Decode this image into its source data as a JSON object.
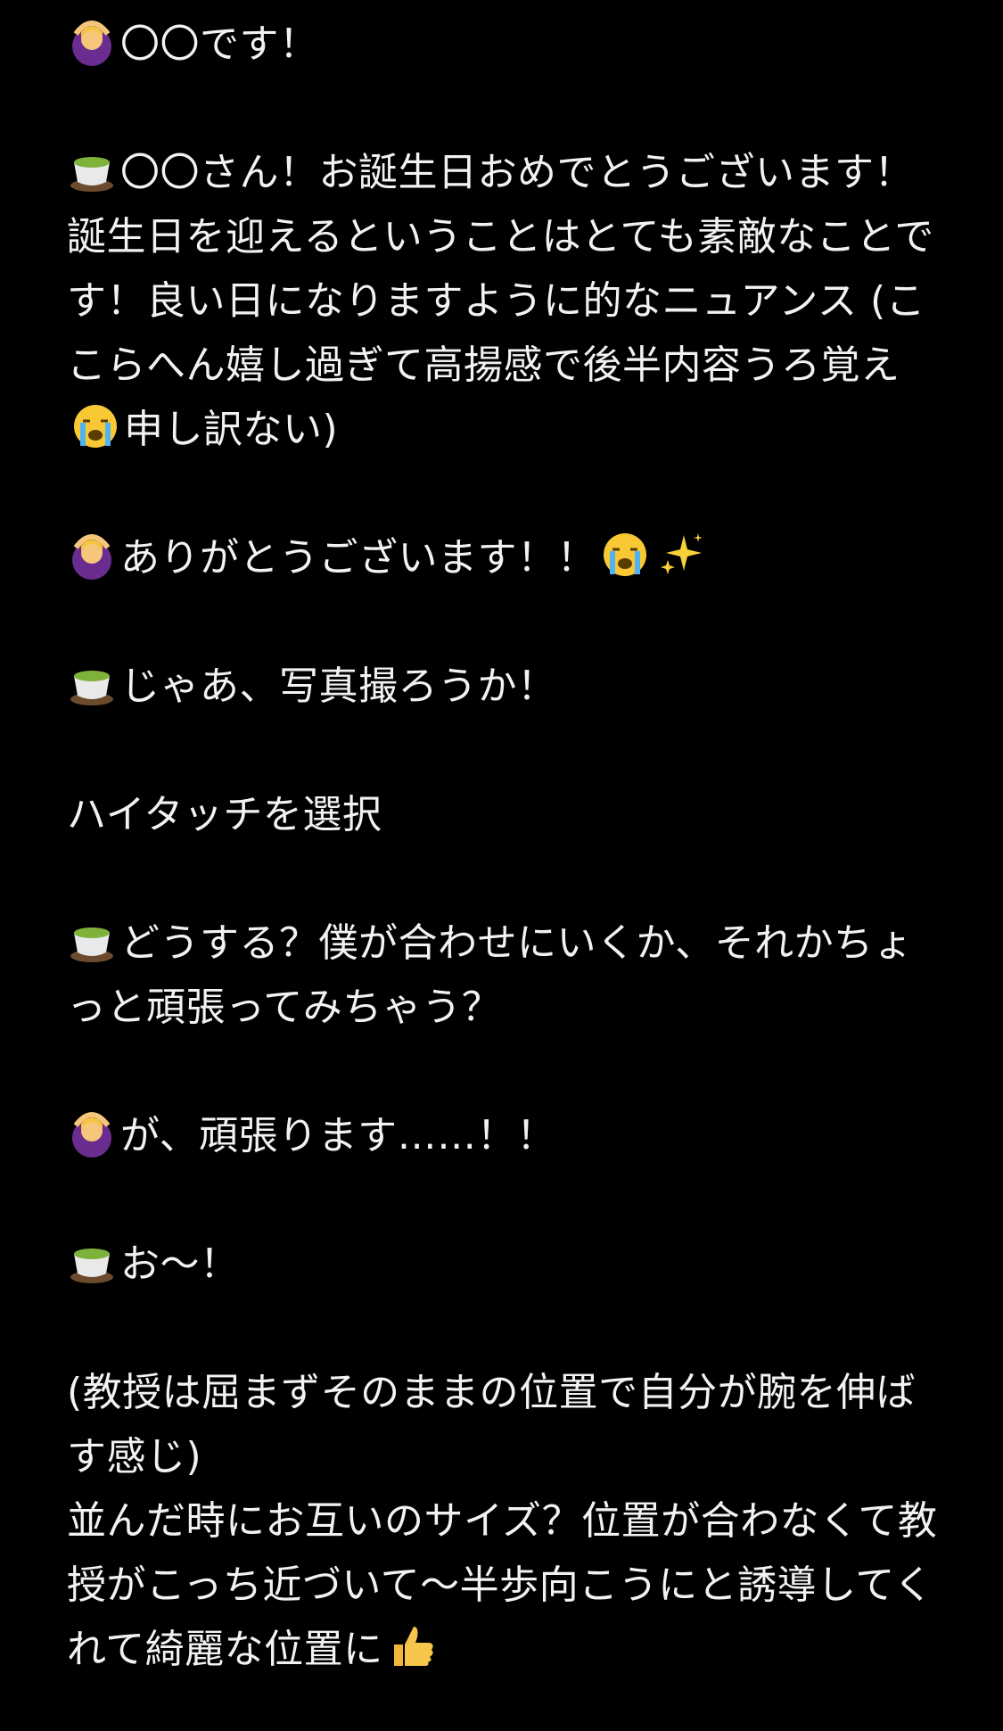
{
  "paragraphs": [
    {
      "speaker": "woman-gesturing-ok",
      "text": "〇〇です！"
    },
    {
      "speaker": "teacup",
      "text": "〇〇さん！お誕生日おめでとうございます！誕生日を迎えるということはとても素敵なことです！良い日になりますように的なニュアンス (ここらへん嬉し過ぎて高揚感で後半内容うろ覚え",
      "after_icon": "loudly-crying-face",
      "tail": "申し訳ない)"
    },
    {
      "speaker": "woman-gesturing-ok",
      "text": "ありがとうございます！！",
      "after_icon": "loudly-crying-face",
      "after_icon2": "sparkles"
    },
    {
      "speaker": "teacup",
      "text": "じゃあ、写真撮ろうか！"
    },
    {
      "speaker": "",
      "text": "ハイタッチを選択"
    },
    {
      "speaker": "teacup",
      "text": "どうする？僕が合わせにいくか、それかちょっと頑張ってみちゃう？"
    },
    {
      "speaker": "woman-gesturing-ok",
      "text": "が、頑張ります……！！"
    },
    {
      "speaker": "teacup",
      "text": "お〜！"
    }
  ],
  "closing": {
    "line1": "(教授は屈まずそのままの位置で自分が腕を伸ばす感じ)",
    "line2": "並んだ時にお互いのサイズ？位置が合わなくて教授がこっち近づいて〜半歩向こうにと誘導してくれて綺麗な位置に",
    "end_icon": "thumbs-up"
  },
  "colors": {
    "background": "#000000",
    "text": "#f2f2f2"
  }
}
